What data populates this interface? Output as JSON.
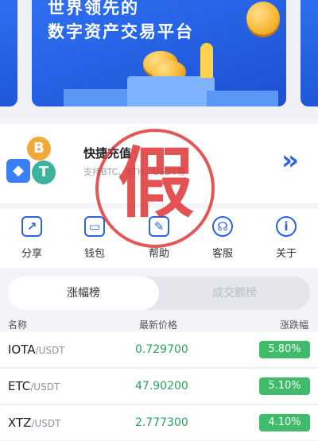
{
  "banner": {
    "line1": "世界领先的",
    "line2": "数字资产交易平台"
  },
  "quick_recharge": {
    "title": "快捷充值",
    "subtitle": "支持BTC、ETH、USDT等",
    "icons": [
      "bitcoin-icon",
      "ethereum-icon",
      "tether-icon"
    ],
    "arrow": "»"
  },
  "menu": [
    {
      "label": "分享",
      "icon": "share-icon"
    },
    {
      "label": "钱包",
      "icon": "wallet-icon"
    },
    {
      "label": "帮助",
      "icon": "help-icon"
    },
    {
      "label": "客服",
      "icon": "customer-service-icon"
    },
    {
      "label": "关于",
      "icon": "info-icon"
    }
  ],
  "stamp": "假",
  "tabs": {
    "active": "涨幅榜",
    "inactive": "成交额榜"
  },
  "table": {
    "headers": {
      "name": "名称",
      "price": "最新价格",
      "change": "涨跌幅"
    },
    "rows": [
      {
        "base": "IOTA",
        "quote": "/USDT",
        "price": "0.729700",
        "change": "5.80%"
      },
      {
        "base": "ETC",
        "quote": "/USDT",
        "price": "47.90200",
        "change": "5.10%"
      },
      {
        "base": "XTZ",
        "quote": "/USDT",
        "price": "2.777300",
        "change": "4.10%"
      }
    ]
  },
  "colors": {
    "accent": "#2b63e0",
    "up": "#3fbb6a",
    "stamp": "#dc2828"
  }
}
